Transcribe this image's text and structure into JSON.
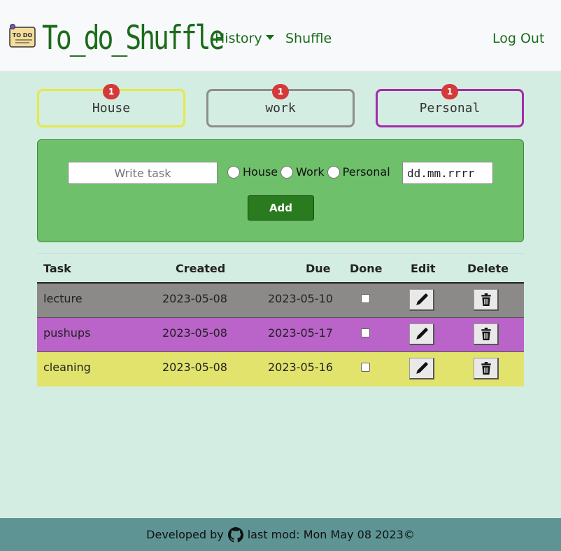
{
  "navbar": {
    "brand": "To_do_Shuffle",
    "logo_text": "TO DO",
    "history_label": "History",
    "shuffle_label": "Shuffle",
    "logout_label": "Log Out"
  },
  "categories": [
    {
      "label": "House",
      "count": "1",
      "color": "#e5e845"
    },
    {
      "label": "work",
      "count": "1",
      "color": "#8d8d8d"
    },
    {
      "label": "Personal",
      "count": "1",
      "color": "#a52aaa"
    }
  ],
  "form": {
    "task_placeholder": "Write task",
    "radio_options": [
      "House",
      "Work",
      "Personal"
    ],
    "date_placeholder": "dd.mm.rrrr",
    "add_label": "Add"
  },
  "table": {
    "headers": [
      "Task",
      "Created",
      "Due",
      "Done",
      "Edit",
      "Delete"
    ],
    "rows": [
      {
        "task": "lecture",
        "created": "2023-05-08",
        "due": "2023-05-10",
        "color": "#8c8989"
      },
      {
        "task": "pushups",
        "created": "2023-05-08",
        "due": "2023-05-17",
        "color": "#ba63c8"
      },
      {
        "task": "cleaning",
        "created": "2023-05-08",
        "due": "2023-05-16",
        "color": "#e1e36d"
      }
    ]
  },
  "footer": {
    "developed_by": "Developed by",
    "last_mod": "last mod: Mon May 08 2023©"
  },
  "icons": {
    "logo": "todo-note-icon",
    "github": "github-icon",
    "edit": "pencil-icon",
    "delete": "trash-icon"
  }
}
